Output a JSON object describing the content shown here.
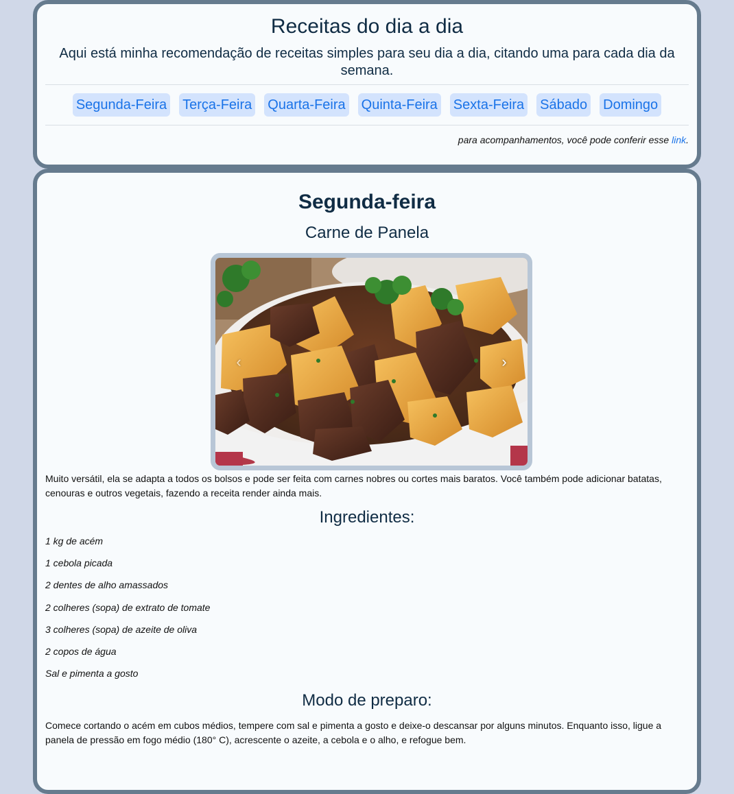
{
  "header": {
    "title": "Receitas do dia a dia",
    "subtitle": "Aqui está minha recomendação de receitas simples para seu dia a dia, citando uma para cada dia da semana.",
    "days": [
      "Segunda-Feira",
      "Terça-Feira",
      "Quarta-Feira",
      "Quinta-Feira",
      "Sexta-Feira",
      "Sábado",
      "Domingo"
    ],
    "note_text": "para acompanhamentos, você pode conferir esse ",
    "note_link": "link",
    "note_end": "."
  },
  "recipe": {
    "day": "Segunda-feira",
    "name": "Carne de Panela",
    "intro": "Muito versátil, ela se adapta a todos os bolsos e pode ser feita com carnes nobres ou cortes mais baratos. Você também pode adicionar batatas, cenouras e outros vegetais, fazendo a receita render ainda mais.",
    "ingredients_heading": "Ingredientes:",
    "ingredients": [
      "1 kg de acém",
      "1 cebola picada",
      "2 dentes de alho amassados",
      "2 colheres (sopa) de extrato de tomate",
      "3 colheres (sopa) de azeite de oliva",
      "2 copos de água",
      "Sal e pimenta a gosto"
    ],
    "prep_heading": "Modo de preparo:",
    "prep_text": "Comece cortando o acém em cubos médios, tempere com sal e pimenta a gosto e deixe-o descansar por alguns minutos. Enquanto isso, ligue a panela de pressão em fogo médio (180° C), acrescente o azeite, a cebola e o alho, e refogue bem."
  },
  "carousel": {
    "prev_icon": "chevron-left-icon",
    "next_icon": "chevron-right-icon",
    "prev_glyph": "‹",
    "next_glyph": "›"
  },
  "colors": {
    "page_bg": "#d0d8e8",
    "card_bg": "#f8fbfd",
    "card_border": "#667b8e",
    "nav_bg": "#d3e3fd",
    "link": "#1a73e8",
    "heading": "#102c44"
  }
}
